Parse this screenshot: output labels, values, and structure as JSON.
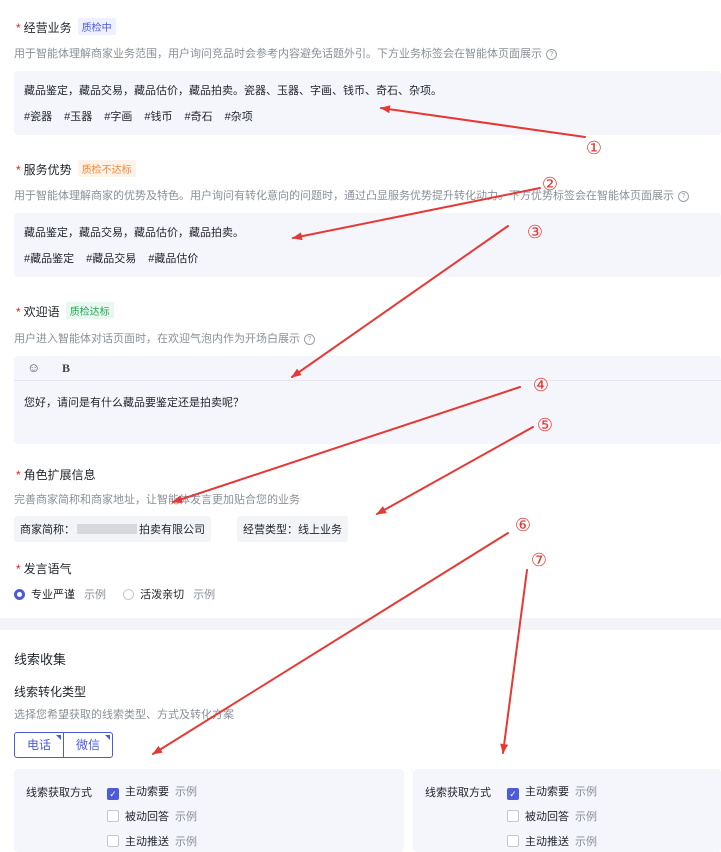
{
  "business": {
    "label": "经营业务",
    "badge": "质检中",
    "desc": "用于智能体理解商家业务范围，用户询问竞品时会参考内容避免话题外引。下方业务标签会在智能体页面展示",
    "text": "藏品鉴定，藏品交易，藏品估价，藏品拍卖。瓷器、玉器、字画、钱币、奇石、杂项。",
    "tags": [
      "#瓷器",
      "#玉器",
      "#字画",
      "#钱币",
      "#奇石",
      "#杂项"
    ]
  },
  "advantage": {
    "label": "服务优势",
    "badge": "质检不达标",
    "desc": "用于智能体理解商家的优势及特色。用户询问有转化意向的问题时，通过凸显服务优势提升转化动力。下方优势标签会在智能体页面展示",
    "text": "藏品鉴定，藏品交易，藏品估价，藏品拍卖。",
    "tags": [
      "#藏品鉴定",
      "#藏品交易",
      "#藏品估价"
    ]
  },
  "welcome": {
    "label": "欢迎语",
    "badge": "质检达标",
    "desc": "用户进入智能体对话页面时，在欢迎气泡内作为开场白展示",
    "toolbar_emoji": "☺",
    "toolbar_bold": "B",
    "text": "您好，请问是有什么藏品要鉴定还是拍卖呢？"
  },
  "role": {
    "label": "角色扩展信息",
    "desc": "完善商家简称和商家地址，让智能体发言更加贴合您的业务",
    "merchant_label": "商家简称：",
    "merchant_tail": "拍卖有限公司",
    "type_label": "经营类型：",
    "type_value": "线上业务"
  },
  "tone": {
    "label": "发言语气",
    "opt1": "专业严谨",
    "opt2": "活泼亲切",
    "example": "示例"
  },
  "leads": {
    "title": "线索收集",
    "type_label": "线索转化类型",
    "type_desc": "选择您希望获取的线索类型、方式及转化方案",
    "btn_phone": "电话",
    "btn_wechat": "微信",
    "method_label": "线索获取方式",
    "opt_active": "主动索要",
    "opt_passive": "被动回答",
    "opt_push": "主动推送",
    "example": "示例"
  },
  "annotations": [
    "①",
    "②",
    "③",
    "④",
    "⑤",
    "⑥",
    "⑦"
  ],
  "colors": {
    "accent": "#4d5bd9",
    "required": "#e2231a",
    "arrow": "#e53935"
  }
}
